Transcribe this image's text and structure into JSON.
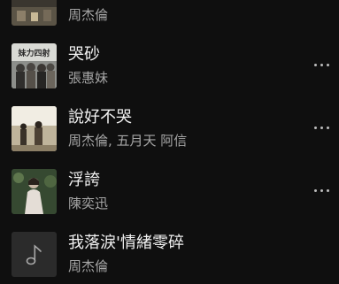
{
  "tracks": [
    {
      "title": "",
      "subtitle": "周杰倫",
      "thumb_icon": "album-cover-icon"
    },
    {
      "title": "哭砂",
      "subtitle": "張惠妹",
      "thumb_icon": "album-cover-icon",
      "cover_text": "妹力四射"
    },
    {
      "title": "說好不哭",
      "subtitle": "周杰倫, 五月天 阿信",
      "thumb_icon": "album-cover-icon"
    },
    {
      "title": "浮誇",
      "subtitle": "陳奕迅",
      "thumb_icon": "album-cover-icon"
    },
    {
      "title": "我落淚'情緒零碎",
      "subtitle": "周杰倫",
      "thumb_icon": "music-note-icon"
    }
  ],
  "colors": {
    "background": "#0f0f0f",
    "title": "#f2f2f2",
    "subtitle": "#a6a6a6",
    "more_dots": "#bdbdbd",
    "placeholder": "#2b2b2b"
  }
}
